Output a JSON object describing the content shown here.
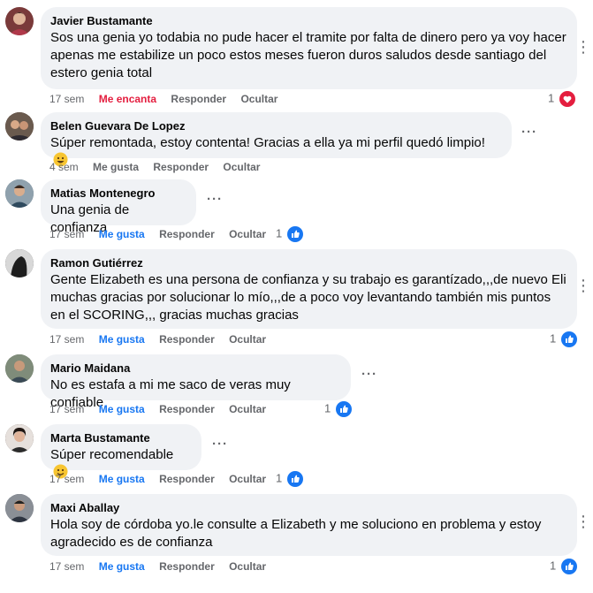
{
  "comments": [
    {
      "author": "Javier Bustamante",
      "text": "Sos una genia yo todabia no pude hacer el tramite por falta de dinero pero ya voy hacer apenas me estabilize un poco estos meses fueron duros saludos desde santiago del estero genia total",
      "time": "17 sem",
      "reaction_action": "Me encanta",
      "reply": "Responder",
      "hide": "Ocultar",
      "reaction_count": "1",
      "reaction_type": "love",
      "avatar_color": "#7a3a3a"
    },
    {
      "author": "Belen Guevara De Lopez",
      "text": "Súper remontada, estoy contenta! Gracias a ella ya mi perfil quedó limpio!",
      "time": "4 sem",
      "reaction_action": "Me gusta",
      "reply": "Responder",
      "hide": "Ocultar",
      "reaction_count": "",
      "reaction_type": "none",
      "avatar_color": "#5b4a3f"
    },
    {
      "author": "Matias Montenegro",
      "text": "Una genia de confianza",
      "time": "17 sem",
      "reaction_action": "Me gusta",
      "reply": "Responder",
      "hide": "Ocultar",
      "reaction_count": "1",
      "reaction_type": "like",
      "avatar_color": "#6b7f8c"
    },
    {
      "author": "Ramon Gutiérrez",
      "text": "Gente Elizabeth es una persona de confianza y su trabajo es garantízado,,,de nuevo Eli muchas gracias por solucionar lo mío,,,de a poco voy levantando también mis puntos en el SCORING,,, gracias muchas gracias",
      "time": "17 sem",
      "reaction_action": "Me gusta",
      "reply": "Responder",
      "hide": "Ocultar",
      "reaction_count": "1",
      "reaction_type": "like",
      "avatar_color": "#3e3e3e"
    },
    {
      "author": "Mario Maidana",
      "text": "No es estafa a mi me saco de veras muy confiable",
      "time": "17 sem",
      "reaction_action": "Me gusta",
      "reply": "Responder",
      "hide": "Ocultar",
      "reaction_count": "1",
      "reaction_type": "like",
      "avatar_color": "#6e7a6a"
    },
    {
      "author": "Marta Bustamante",
      "text": "Súper recomendable",
      "time": "17 sem",
      "reaction_action": "Me gusta",
      "reply": "Responder",
      "hide": "Ocultar",
      "reaction_count": "1",
      "reaction_type": "like",
      "avatar_color": "#4a3a36"
    },
    {
      "author": "Maxi Aballay",
      "text": "Hola soy de córdoba yo.le consulte a Elizabeth y me soluciono en problema y estoy agradecido es de confianza",
      "time": "17 sem",
      "reaction_action": "Me gusta",
      "reply": "Responder",
      "hide": "Ocultar",
      "reaction_count": "1",
      "reaction_type": "like",
      "avatar_color": "#556070"
    }
  ],
  "colors": {
    "bubble": "#f0f2f5",
    "like_blue": "#1877f2",
    "love_red": "#e41e3f",
    "meta_gray": "#65676b"
  },
  "icons": [
    "more-options-icon",
    "like-reaction-icon",
    "love-reaction-icon",
    "smile-emoji-icon"
  ]
}
